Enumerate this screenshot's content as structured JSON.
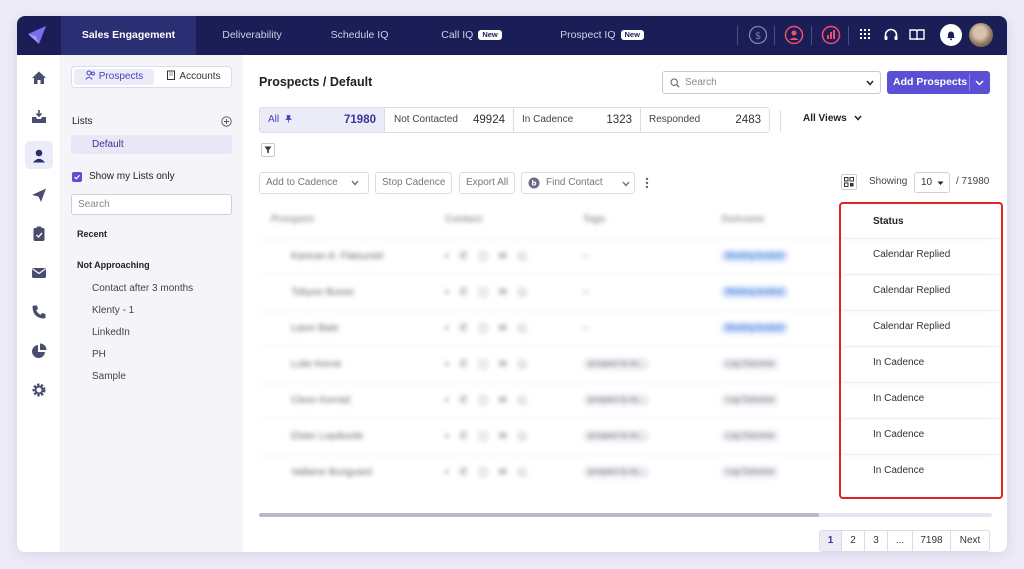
{
  "topnav": {
    "items": [
      {
        "label": "Sales Engagement",
        "active": true
      },
      {
        "label": "Deliverability"
      },
      {
        "label": "Schedule IQ"
      },
      {
        "label": "Call IQ",
        "badge": "New"
      },
      {
        "label": "Prospect IQ",
        "badge": "New"
      }
    ],
    "icons": [
      "dollar-icon",
      "user-circle-icon",
      "chart-icon",
      "apps-grid-icon",
      "headset-icon",
      "book-icon",
      "bell-icon"
    ]
  },
  "rail": {
    "icons": [
      "home-icon",
      "inbox-icon",
      "user-icon",
      "send-icon",
      "clipboard-icon",
      "mail-icon",
      "phone-icon",
      "pie-chart-icon",
      "gear-icon"
    ]
  },
  "lists_panel": {
    "seg_prospects": "Prospects",
    "seg_accounts": "Accounts",
    "lists_label": "Lists",
    "selected_list": "Default",
    "show_my_lists": "Show my Lists only",
    "search_placeholder": "Search",
    "recent_label": "Recent",
    "group_label": "Not Approaching",
    "group_items": [
      "Contact after 3 months",
      "Klenty - 1",
      "LinkedIn",
      "PH",
      "Sample"
    ]
  },
  "main": {
    "title": "Prospects / Default",
    "search_placeholder": "Search",
    "add_button": "Add Prospects",
    "tabs": [
      {
        "label": "All",
        "count": "71980",
        "active": true
      },
      {
        "label": "Not Contacted",
        "count": "49924"
      },
      {
        "label": "In Cadence",
        "count": "1323"
      },
      {
        "label": "Responded",
        "count": "2483"
      }
    ],
    "all_views": "All Views",
    "toolbar": {
      "add_to_cadence": "Add to Cadence",
      "stop_cadence": "Stop Cadence",
      "export_all": "Export All",
      "find_contact": "Find Contact"
    },
    "showing_label": "Showing",
    "page_size": "10",
    "total": "/ 71980"
  },
  "table": {
    "headers": [
      "Prospect",
      "Contact",
      "Tags",
      "Outcome",
      "Status"
    ],
    "rows": [
      {
        "prospect": "Kamran A. Flatsuniel",
        "tags": "–",
        "outcome": "Meeting booked",
        "status": "Calendar Replied"
      },
      {
        "prospect": "Tobyon Busse",
        "tags": "–",
        "outcome": "Meeting booked",
        "status": "Calendar Replied"
      },
      {
        "prospect": "Liann Bate",
        "tags": "–",
        "outcome": "Meeting booked",
        "status": "Calendar Replied"
      },
      {
        "prospect": "Lulie Kerne",
        "tags": "prospect la int...",
        "outcome": "Log Outcome",
        "status": "In Cadence"
      },
      {
        "prospect": "Cleon Kerrad",
        "tags": "prospect la int...",
        "outcome": "Log Outcome",
        "status": "In Cadence"
      },
      {
        "prospect": "Elsler Lopdiurde",
        "tags": "prospect la int...",
        "outcome": "Log Outcome",
        "status": "In Cadence"
      },
      {
        "prospect": "Vallaine Bunguard",
        "tags": "prospect la int...",
        "outcome": "Log Outcome",
        "status": "In Cadence"
      }
    ]
  },
  "pagination": [
    "1",
    "2",
    "3",
    "...",
    "7198",
    "Next"
  ],
  "colors": {
    "nav_bg": "#1b1e56",
    "accent": "#5b4fd4",
    "highlight_border": "#e02424"
  }
}
